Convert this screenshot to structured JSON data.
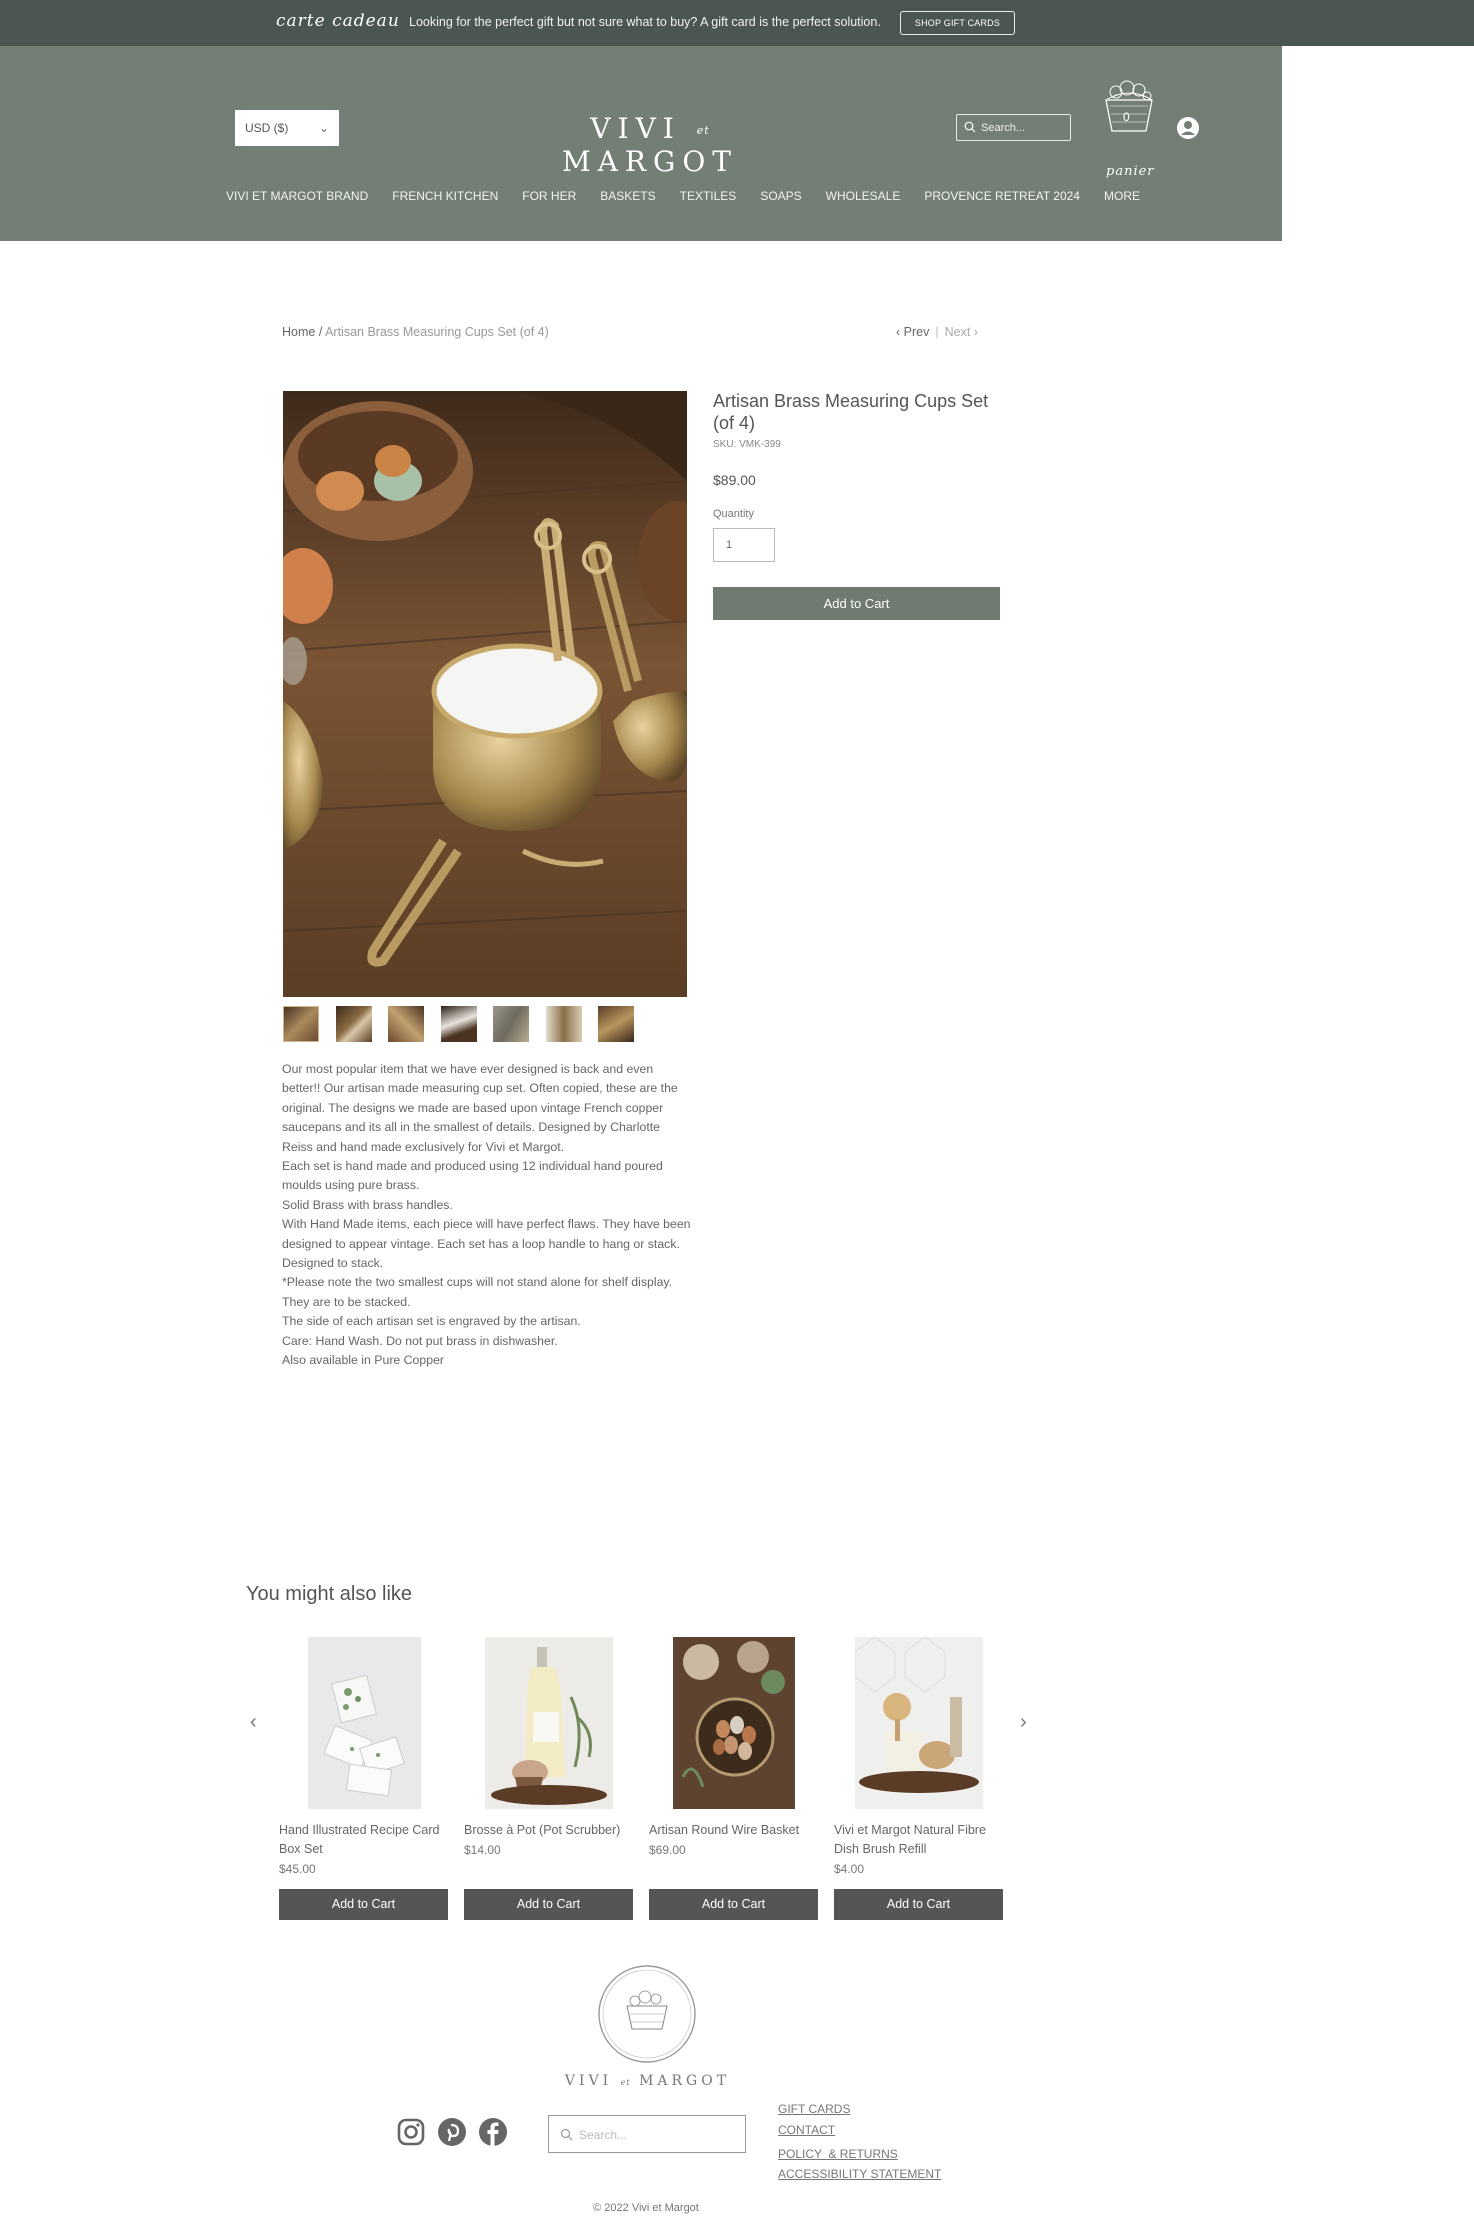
{
  "promo": {
    "brand": "carte cadeau",
    "message": "Looking for the perfect gift but not sure what to buy? A gift card is the perfect solution.",
    "button": "SHOP GIFT CARDS"
  },
  "header": {
    "currency": "USD ($)",
    "logo_left": "VIVI",
    "logo_et": "et",
    "logo_right": "MARGOT",
    "search_placeholder": "Search...",
    "cart_count": "0",
    "cart_label": "panier",
    "nav": [
      "VIVI ET MARGOT BRAND",
      "FRENCH KITCHEN",
      "FOR HER",
      "BASKETS",
      "TEXTILES",
      "SOAPS",
      "WHOLESALE",
      "PROVENCE RETREAT 2024",
      "MORE"
    ]
  },
  "breadcrumb": {
    "home": "Home",
    "separator": " / ",
    "current": "Artisan Brass Measuring Cups Set (of 4)",
    "prev": "Prev",
    "next": "Next"
  },
  "product": {
    "title": "Artisan Brass Measuring Cups Set (of 4)",
    "sku": "SKU: VMK-399",
    "price": "$89.00",
    "quantity_label": "Quantity",
    "quantity": "1",
    "add_to_cart": "Add to Cart",
    "thumbnail_count": 7,
    "description": [
      "Our most popular item that we have ever designed is back and even better!! Our artisan made measuring cup set. Often copied, these are the original. The designs we made are based upon vintage French copper saucepans and its all in the smallest of details. Designed by Charlotte Reiss and hand made exclusively for Vivi et Margot.",
      "Each set is hand made and produced using 12 individual hand poured moulds using pure brass.",
      "Solid Brass with brass handles.",
      "With Hand Made items, each piece will have perfect flaws. They have been designed to appear vintage. Each set has a loop handle to hang or stack. Designed to stack.",
      "*Please note the two smallest cups will not stand alone for shelf display. They are to be stacked.",
      "The side of each artisan set is engraved by the artisan.",
      "Care: Hand Wash. Do not put brass in dishwasher.",
      "Also available in Pure Copper"
    ]
  },
  "related": {
    "title": "You might also like",
    "items": [
      {
        "name": "Hand Illustrated Recipe Card Box Set",
        "price": "$45.00",
        "button": "Add to Cart"
      },
      {
        "name": "Brosse à Pot (Pot Scrubber)",
        "price": "$14.00",
        "button": "Add to Cart"
      },
      {
        "name": "Artisan Round Wire Basket",
        "price": "$69.00",
        "button": "Add to Cart"
      },
      {
        "name": "Vivi et Margot Natural Fibre Dish Brush Refill",
        "price": "$4.00",
        "button": "Add to Cart"
      }
    ]
  },
  "footer": {
    "wordmark_left": "VIVI",
    "wordmark_et": "et",
    "wordmark_right": "MARGOT",
    "search_placeholder": "Search...",
    "links": [
      "GIFT CARDS",
      "CONTACT",
      "POLICY  & RETURNS",
      "ACCESSIBILITY STATEMENT"
    ],
    "copyright": "© 2022 Vivi et Margot",
    "socials": [
      "instagram-icon",
      "pinterest-icon",
      "facebook-icon"
    ]
  },
  "colors": {
    "promo_bg": "#4b5650",
    "header_bg": "#737f74",
    "add_main": "#6f7a70",
    "add_related": "#555555"
  }
}
